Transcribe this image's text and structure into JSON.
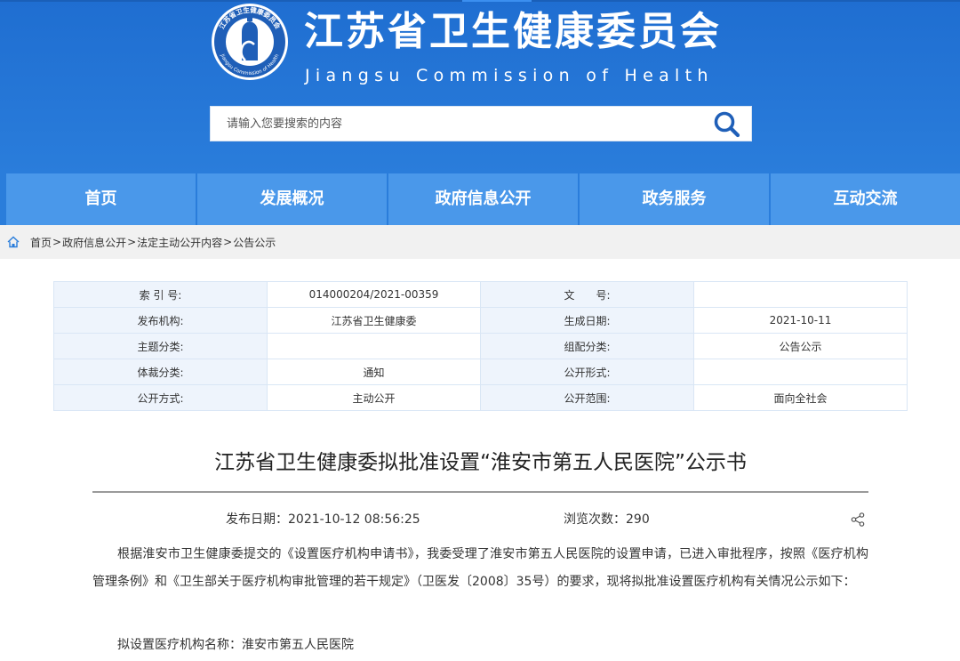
{
  "header": {
    "title": "江苏省卫生健康委员会",
    "subtitle": "Jiangsu Commission of Health",
    "logo_ring_text_cn": "江苏省卫生健康委员会",
    "logo_ring_text_en": "Jiangsu Commission of Health",
    "search_placeholder": "请输入您要搜索的内容"
  },
  "nav": {
    "items": [
      {
        "label": "首页"
      },
      {
        "label": "发展概况"
      },
      {
        "label": "政府信息公开"
      },
      {
        "label": "政务服务"
      },
      {
        "label": "互动交流"
      }
    ]
  },
  "breadcrumb": {
    "items": [
      "首页",
      "政府信息公开",
      "法定主动公开内容",
      "公告公示"
    ],
    "separator": ">"
  },
  "meta": {
    "rows": [
      [
        "索 引 号:",
        "014000204/2021-00359",
        "文　　号:",
        ""
      ],
      [
        "发布机构:",
        "江苏省卫生健康委",
        "生成日期:",
        "2021-10-11"
      ],
      [
        "主题分类:",
        "",
        "组配分类:",
        "公告公示"
      ],
      [
        "体裁分类:",
        "通知",
        "公开形式:",
        ""
      ],
      [
        "公开方式:",
        "主动公开",
        "公开范围:",
        "面向全社会"
      ]
    ]
  },
  "article": {
    "title": "江苏省卫生健康委拟批准设置“淮安市第五人民医院”公示书",
    "pub_date": "发布日期：2021-10-12 08:56:25",
    "views": "浏览次数：290",
    "paragraph": "根据淮安市卫生健康委提交的《设置医疗机构申请书》，我委受理了淮安市第五人民医院的设置申请，已进入审批程序，按照《医疗机构管理条例》和《卫生部关于医疗机构审批管理的若干规定》（卫医发〔2008〕35号）的要求，现将拟批准设置医疗机构有关情况公示如下：",
    "line1": "拟设置医疗机构名称：淮安市第五人民医院"
  },
  "colors": {
    "header_blue": "#1f6ed1",
    "nav_item": "#4a98ea",
    "table_label_bg": "#eef4fc",
    "table_border": "#d9e6f5"
  }
}
